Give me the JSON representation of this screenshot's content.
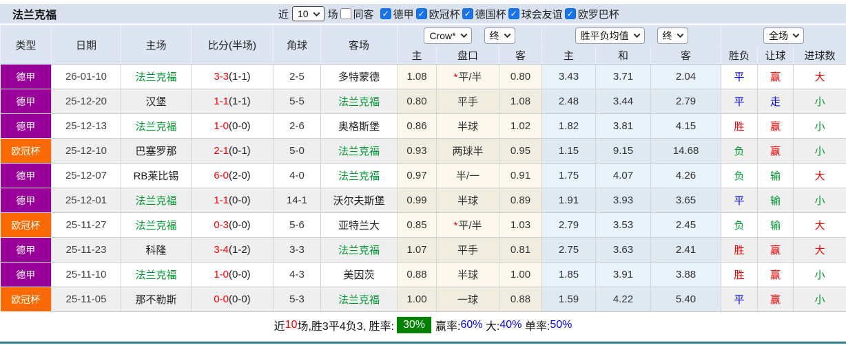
{
  "title": "法兰克福",
  "filters": {
    "recent_prefix": "近",
    "recent_value": "10",
    "recent_suffix": "场",
    "same_venue_label": "同客",
    "same_venue_checked": false,
    "competitions": [
      {
        "label": "德甲",
        "checked": true
      },
      {
        "label": "欧冠杯",
        "checked": true
      },
      {
        "label": "德国杯",
        "checked": true
      },
      {
        "label": "球会友谊",
        "checked": true
      },
      {
        "label": "欧罗巴杯",
        "checked": true
      }
    ]
  },
  "header": {
    "columns": [
      "类型",
      "日期",
      "主场",
      "比分(半场)",
      "角球",
      "客场"
    ],
    "odds_dropdowns": [
      {
        "label": "Crow*"
      },
      {
        "label": "终"
      }
    ],
    "avg_dropdowns": [
      {
        "label": "胜平负均值"
      },
      {
        "label": "终"
      }
    ],
    "result_dropdown": "全场",
    "sub_columns": [
      "主",
      "盘口",
      "客",
      "主",
      "和",
      "客",
      "胜负",
      "让球",
      "进球数"
    ]
  },
  "rows": [
    {
      "league": "德甲",
      "league_color": "purple",
      "date": "26-01-10",
      "home": "法兰克福",
      "home_team": true,
      "score_main": "3-3",
      "score_half": "(1-1)",
      "corner": "2-5",
      "away": "多特蒙德",
      "away_team": false,
      "odds_home": "1.08",
      "handicap_star": "*",
      "handicap": "平/半",
      "odds_away": "0.80",
      "avg_home": "3.43",
      "avg_draw": "3.71",
      "avg_away": "2.04",
      "result": "平",
      "result_color": "blue",
      "handicap_result": "赢",
      "handicap_result_color": "red",
      "goals": "大",
      "goals_color": "red"
    },
    {
      "league": "德甲",
      "league_color": "purple",
      "date": "25-12-20",
      "home": "汉堡",
      "home_team": false,
      "score_main": "1-1",
      "score_half": "(1-1)",
      "corner": "5-5",
      "away": "法兰克福",
      "away_team": true,
      "odds_home": "0.80",
      "handicap_star": "",
      "handicap": "平手",
      "odds_away": "1.08",
      "avg_home": "2.48",
      "avg_draw": "3.44",
      "avg_away": "2.79",
      "result": "平",
      "result_color": "blue",
      "handicap_result": "走",
      "handicap_result_color": "blue",
      "goals": "小",
      "goals_color": "green"
    },
    {
      "league": "德甲",
      "league_color": "purple",
      "date": "25-12-13",
      "home": "法兰克福",
      "home_team": true,
      "score_main": "1-0",
      "score_half": "(0-0)",
      "corner": "2-6",
      "away": "奥格斯堡",
      "away_team": false,
      "odds_home": "0.86",
      "handicap_star": "",
      "handicap": "半球",
      "odds_away": "1.02",
      "avg_home": "1.82",
      "avg_draw": "3.81",
      "avg_away": "4.15",
      "result": "胜",
      "result_color": "red",
      "handicap_result": "赢",
      "handicap_result_color": "red",
      "goals": "小",
      "goals_color": "green"
    },
    {
      "league": "欧冠杯",
      "league_color": "orange",
      "date": "25-12-10",
      "home": "巴塞罗那",
      "home_team": false,
      "score_main": "2-1",
      "score_half": "(0-1)",
      "corner": "5-0",
      "away": "法兰克福",
      "away_team": true,
      "odds_home": "0.93",
      "handicap_star": "",
      "handicap": "两球半",
      "odds_away": "0.95",
      "avg_home": "1.15",
      "avg_draw": "9.15",
      "avg_away": "14.68",
      "result": "负",
      "result_color": "green",
      "handicap_result": "赢",
      "handicap_result_color": "red",
      "goals": "小",
      "goals_color": "green"
    },
    {
      "league": "德甲",
      "league_color": "purple",
      "date": "25-12-07",
      "home": "RB莱比锡",
      "home_team": false,
      "score_main": "6-0",
      "score_half": "(2-0)",
      "corner": "4-0",
      "away": "法兰克福",
      "away_team": true,
      "odds_home": "0.97",
      "handicap_star": "",
      "handicap": "半/一",
      "odds_away": "0.91",
      "avg_home": "1.75",
      "avg_draw": "4.07",
      "avg_away": "4.26",
      "result": "负",
      "result_color": "green",
      "handicap_result": "输",
      "handicap_result_color": "green",
      "goals": "大",
      "goals_color": "red"
    },
    {
      "league": "德甲",
      "league_color": "purple",
      "date": "25-12-01",
      "home": "法兰克福",
      "home_team": true,
      "score_main": "1-1",
      "score_half": "(0-0)",
      "corner": "14-1",
      "away": "沃尔夫斯堡",
      "away_team": false,
      "odds_home": "0.99",
      "handicap_star": "",
      "handicap": "半球",
      "odds_away": "0.89",
      "avg_home": "1.91",
      "avg_draw": "3.93",
      "avg_away": "3.65",
      "result": "平",
      "result_color": "blue",
      "handicap_result": "输",
      "handicap_result_color": "green",
      "goals": "小",
      "goals_color": "green"
    },
    {
      "league": "欧冠杯",
      "league_color": "orange",
      "date": "25-11-27",
      "home": "法兰克福",
      "home_team": true,
      "score_main": "0-3",
      "score_half": "(0-0)",
      "corner": "5-6",
      "away": "亚特兰大",
      "away_team": false,
      "odds_home": "0.85",
      "handicap_star": "*",
      "handicap": "平/半",
      "odds_away": "1.03",
      "avg_home": "2.79",
      "avg_draw": "3.53",
      "avg_away": "2.45",
      "result": "负",
      "result_color": "green",
      "handicap_result": "输",
      "handicap_result_color": "green",
      "goals": "大",
      "goals_color": "red"
    },
    {
      "league": "德甲",
      "league_color": "purple",
      "date": "25-11-23",
      "home": "科隆",
      "home_team": false,
      "score_main": "3-4",
      "score_half": "(1-2)",
      "corner": "3-3",
      "away": "法兰克福",
      "away_team": true,
      "odds_home": "1.07",
      "handicap_star": "",
      "handicap": "平手",
      "odds_away": "0.81",
      "avg_home": "2.75",
      "avg_draw": "3.63",
      "avg_away": "2.41",
      "result": "胜",
      "result_color": "red",
      "handicap_result": "赢",
      "handicap_result_color": "red",
      "goals": "大",
      "goals_color": "red"
    },
    {
      "league": "德甲",
      "league_color": "purple",
      "date": "25-11-10",
      "home": "法兰克福",
      "home_team": true,
      "score_main": "1-0",
      "score_half": "(0-0)",
      "corner": "4-3",
      "away": "美因茨",
      "away_team": false,
      "odds_home": "0.88",
      "handicap_star": "",
      "handicap": "半球",
      "odds_away": "1.00",
      "avg_home": "1.85",
      "avg_draw": "3.91",
      "avg_away": "3.88",
      "result": "胜",
      "result_color": "red",
      "handicap_result": "赢",
      "handicap_result_color": "red",
      "goals": "小",
      "goals_color": "green"
    },
    {
      "league": "欧冠杯",
      "league_color": "orange",
      "date": "25-11-05",
      "home": "那不勒斯",
      "home_team": false,
      "score_main": "0-0",
      "score_half": "(0-0)",
      "corner": "5-3",
      "away": "法兰克福",
      "away_team": true,
      "odds_home": "1.00",
      "handicap_star": "",
      "handicap": "一球",
      "odds_away": "0.88",
      "avg_home": "1.59",
      "avg_draw": "4.22",
      "avg_away": "5.40",
      "result": "平",
      "result_color": "blue",
      "handicap_result": "赢",
      "handicap_result_color": "red",
      "goals": "小",
      "goals_color": "green"
    }
  ],
  "footer": {
    "segments": [
      {
        "text": "近",
        "type": "plain"
      },
      {
        "text": "10",
        "type": "red"
      },
      {
        "text": "场,胜3平4负3, 胜率:",
        "type": "plain"
      },
      {
        "text": "30%",
        "type": "badge"
      },
      {
        "text": "赢率:",
        "type": "plain"
      },
      {
        "text": "60%",
        "type": "blue"
      },
      {
        "text": " 大:",
        "type": "plain"
      },
      {
        "text": "40%",
        "type": "blue"
      },
      {
        "text": " 单率:",
        "type": "plain"
      },
      {
        "text": "50%",
        "type": "blue"
      }
    ]
  },
  "colors": {
    "purple": "#990099",
    "orange": "#ff6a00",
    "red": "#f00000",
    "blue": "#0000e6",
    "green": "#009933",
    "team_green": "#009933",
    "team_dark": "#222222",
    "checkbox_blue": "#1a73e8",
    "badge_green": "#008000",
    "bottom_teal": "#35788a"
  }
}
